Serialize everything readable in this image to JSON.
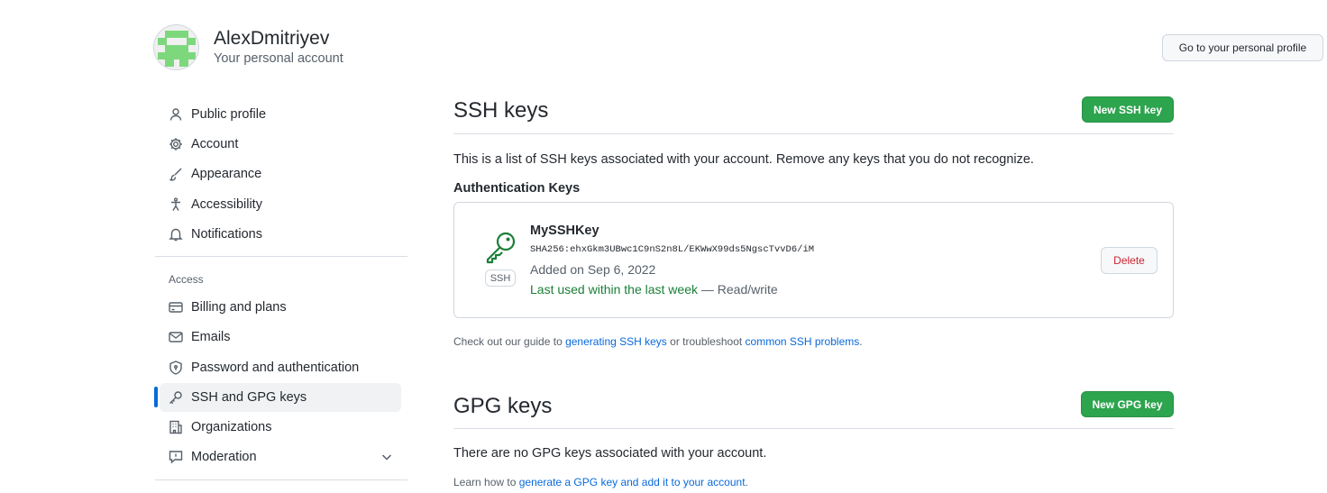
{
  "header": {
    "account_name": "AlexDmitriyev",
    "account_subtitle": "Your personal account",
    "profile_button_label": "Go to your personal profile"
  },
  "sidebar": {
    "items": [
      {
        "label": "Public profile",
        "icon": "person-icon"
      },
      {
        "label": "Account",
        "icon": "gear-icon"
      },
      {
        "label": "Appearance",
        "icon": "paintbrush-icon"
      },
      {
        "label": "Accessibility",
        "icon": "accessibility-icon"
      },
      {
        "label": "Notifications",
        "icon": "bell-icon"
      }
    ],
    "access_label": "Access",
    "access_items": [
      {
        "label": "Billing and plans",
        "icon": "credit-card-icon"
      },
      {
        "label": "Emails",
        "icon": "mail-icon"
      },
      {
        "label": "Password and authentication",
        "icon": "shield-lock-icon"
      },
      {
        "label": "SSH and GPG keys",
        "icon": "key-icon",
        "active": true
      },
      {
        "label": "Organizations",
        "icon": "organization-icon"
      },
      {
        "label": "Moderation",
        "icon": "report-icon"
      }
    ]
  },
  "ssh": {
    "title": "SSH keys",
    "new_button_label": "New SSH key",
    "intro": "This is a list of SSH keys associated with your account. Remove any keys that you do not recognize.",
    "auth_heading": "Authentication Keys",
    "key": {
      "badge": "SSH",
      "title": "MySSHKey",
      "fingerprint": "SHA256:ehxGkm3UBwc1C9nS2n8L/EKWwX99ds5NgscTvvD6/iM",
      "added": "Added on Sep 6, 2022",
      "last_used": "Last used within the last week",
      "access": " — Read/write",
      "delete_label": "Delete"
    },
    "guide": {
      "prefix": "Check out our guide to ",
      "link1": "generating SSH keys",
      "middle": " or troubleshoot ",
      "link2": "common SSH problems",
      "suffix": "."
    }
  },
  "gpg": {
    "title": "GPG keys",
    "new_button_label": "New GPG key",
    "empty": "There are no GPG keys associated with your account.",
    "learn": {
      "prefix": "Learn how to ",
      "link": "generate a GPG key and add it to your account",
      "suffix": "."
    }
  },
  "colors": {
    "accent": "#0969da",
    "primary_button": "#2da44e",
    "danger": "#cf222e",
    "success_text": "#1a7f37"
  }
}
